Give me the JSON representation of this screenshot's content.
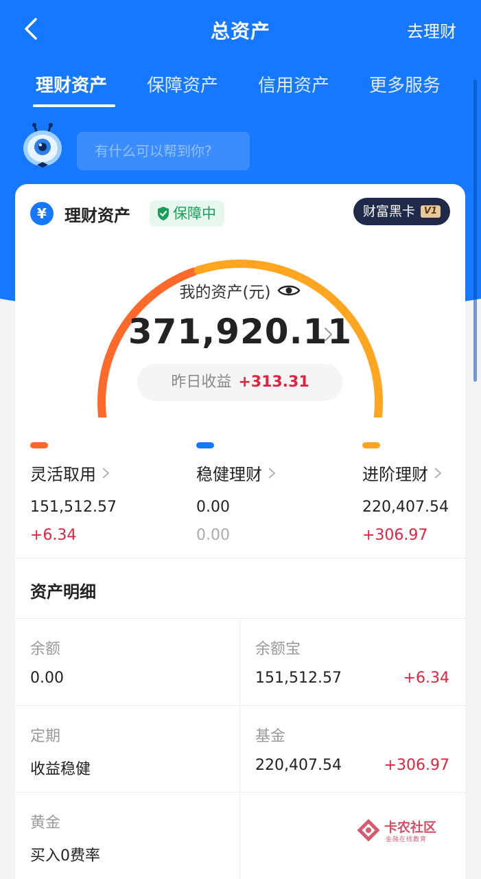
{
  "header": {
    "title": "总资产",
    "right_action": "去理财"
  },
  "tabs": [
    {
      "label": "理财资产",
      "active": true
    },
    {
      "label": "保障资产",
      "active": false
    },
    {
      "label": "信用资产",
      "active": false
    },
    {
      "label": "更多服务",
      "active": false
    }
  ],
  "assistant": {
    "placeholder": "有什么可以帮到你?"
  },
  "card": {
    "title": "理财资产",
    "badge": "保障中",
    "black_card": "财富黑卡",
    "black_card_level": "V1",
    "asset_label": "我的资产(元)",
    "asset_value": "371,920.11",
    "yesterday_label": "昨日收益",
    "yesterday_gain": "+313.31"
  },
  "categories": [
    {
      "name": "灵活取用",
      "value": "151,512.57",
      "gain": "+6.34",
      "color": "#ff6a2a"
    },
    {
      "name": "稳健理财",
      "value": "0.00",
      "gain": "0.00",
      "color": "#1677ff"
    },
    {
      "name": "进阶理财",
      "value": "220,407.54",
      "gain": "+306.97",
      "color": "#ffa51f"
    }
  ],
  "details": {
    "title": "资产明细",
    "items": [
      {
        "label": "余额",
        "value": "0.00",
        "gain": ""
      },
      {
        "label": "余额宝",
        "value": "151,512.57",
        "gain": "+6.34"
      },
      {
        "label": "定期",
        "value": "收益稳健",
        "gain": ""
      },
      {
        "label": "基金",
        "value": "220,407.54",
        "gain": "+306.97"
      },
      {
        "label": "黄金",
        "value": "买入0费率",
        "gain": ""
      }
    ]
  },
  "gauge": {
    "share_flexible": 0.407,
    "share_advanced": 0.593,
    "colors": {
      "flexible": "#ff6a2a",
      "advanced": "#ffa51f"
    }
  },
  "watermark": {
    "name": "卡农社区",
    "sub": "金融在线教育"
  },
  "colors": {
    "brand_blue": "#1677ff",
    "gain_red": "#e2233e",
    "protect_green": "#18a058"
  }
}
